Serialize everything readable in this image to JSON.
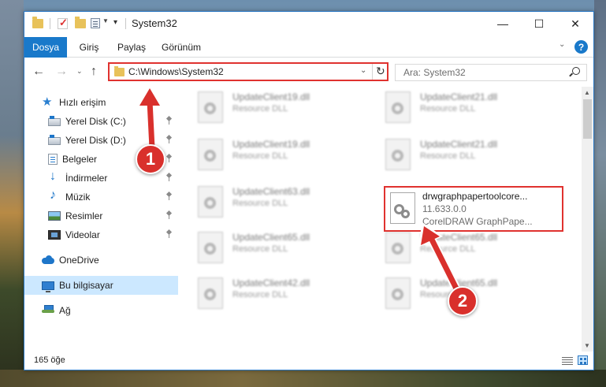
{
  "window": {
    "title": "System32",
    "minimize": "—",
    "maximize": "☐",
    "close": "✕"
  },
  "ribbon": {
    "tabs": [
      "Dosya",
      "Giriş",
      "Paylaş",
      "Görünüm"
    ],
    "expand_icon": "chevron-down-icon",
    "help": "?"
  },
  "nav": {
    "back": "←",
    "forward": "→",
    "recent": "⌄",
    "up": "↑",
    "address": "C:\\Windows\\System32",
    "address_dropdown": "⌄",
    "refresh": "↻",
    "search_placeholder": "Ara: System32"
  },
  "sidebar": {
    "items": [
      {
        "label": "Hızlı erişim",
        "icon": "star-icon"
      },
      {
        "label": "Yerel Disk (C:)",
        "icon": "disk-icon",
        "pinned": true
      },
      {
        "label": "Yerel Disk (D:)",
        "icon": "disk-icon",
        "pinned": true
      },
      {
        "label": "Belgeler",
        "icon": "document-icon",
        "pinned": true
      },
      {
        "label": "İndirmeler",
        "icon": "download-icon",
        "pinned": true
      },
      {
        "label": "Müzik",
        "icon": "music-icon",
        "pinned": true
      },
      {
        "label": "Resimler",
        "icon": "picture-icon",
        "pinned": true
      },
      {
        "label": "Videolar",
        "icon": "video-icon",
        "pinned": true
      },
      {
        "label": "OneDrive",
        "icon": "cloud-icon"
      },
      {
        "label": "Bu bilgisayar",
        "icon": "computer-icon",
        "selected": true
      },
      {
        "label": "Ağ",
        "icon": "network-icon"
      }
    ]
  },
  "files": [
    {
      "name": "UpdateClient19.dll",
      "type": "Resource DLL"
    },
    {
      "name": "UpdateClient21.dll",
      "type": "Resource DLL"
    },
    {
      "name": "UpdateClient19.dll",
      "type": "Resource DLL"
    },
    {
      "name": "UpdateClient21.dll",
      "type": "Resource DLL"
    },
    {
      "name": "UpdateClient63.dll",
      "type": "Resource DLL"
    },
    {
      "name": "UpdateClient65.dll",
      "type": "Resource DLL"
    },
    {
      "name": "UpdateClient65.dll",
      "type": "Resource DLL"
    },
    {
      "name": "UpdateClient42.dll",
      "type": "Resource DLL"
    },
    {
      "name": "UpdateClient65.dll",
      "type": "Resource DLL"
    }
  ],
  "highlighted_file": {
    "name": "drwgraphpapertoolcore...",
    "version": "11.633.0.0",
    "description": "CorelDRAW GraphPape..."
  },
  "status": {
    "count": "165 öğe"
  },
  "annotations": {
    "step1": "1",
    "step2": "2"
  },
  "colors": {
    "accent": "#1979ca",
    "highlight": "#e0322f",
    "selected": "#cce8ff"
  }
}
